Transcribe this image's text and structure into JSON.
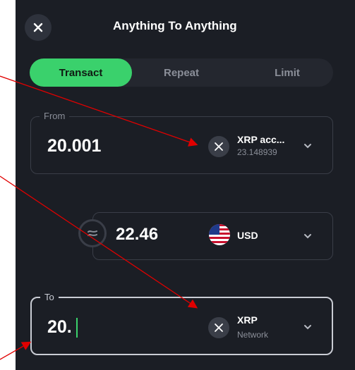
{
  "header": {
    "title": "Anything To Anything",
    "close_icon": "close-icon"
  },
  "tabs": [
    {
      "label": "Transact",
      "active": true
    },
    {
      "label": "Repeat",
      "active": false
    },
    {
      "label": "Limit",
      "active": false
    }
  ],
  "from": {
    "legend": "From",
    "amount": "20.001",
    "asset_name": "XRP acc...",
    "asset_balance": "23.148939",
    "icon": "xrp-icon"
  },
  "fiat": {
    "amount": "22.46",
    "currency": "USD",
    "icon": "us-flag-icon"
  },
  "to": {
    "legend": "To",
    "amount": "20.",
    "asset_name": "XRP",
    "asset_network": "Network",
    "icon": "xrp-icon"
  },
  "colors": {
    "background": "#1b1e25",
    "accent": "#3ad16c",
    "border": "#3a3e48",
    "annotation_arrow": "#e00000"
  }
}
